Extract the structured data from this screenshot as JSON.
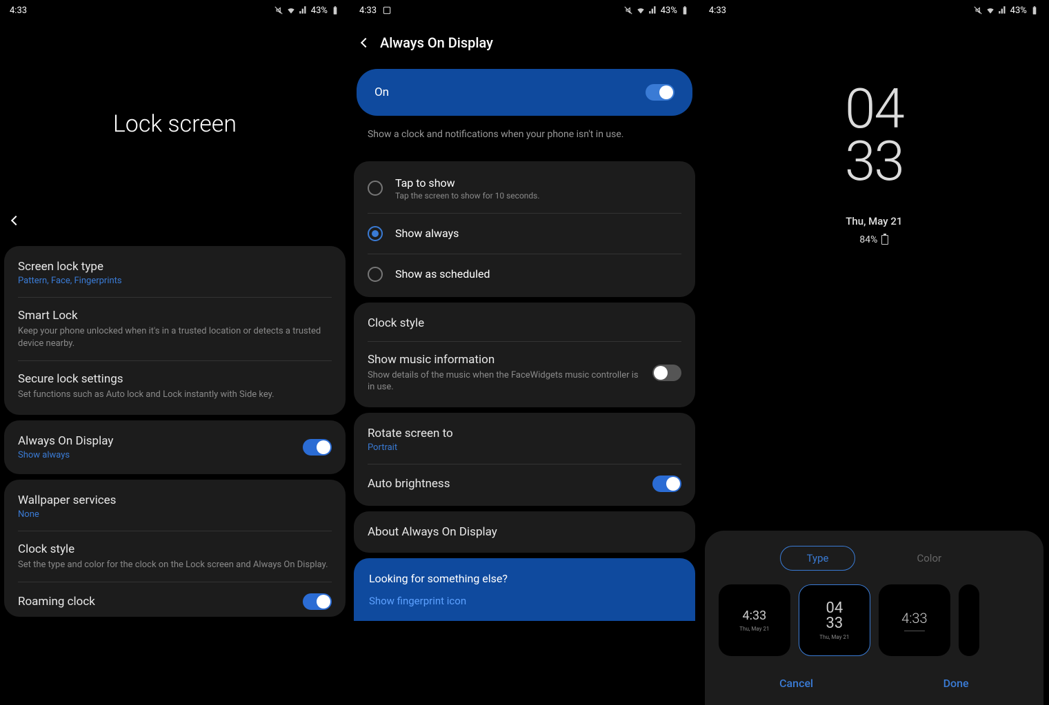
{
  "status": {
    "time": "4:33",
    "battery": "43%"
  },
  "screen1": {
    "title": "Lock screen",
    "group1": {
      "lock_type": {
        "title": "Screen lock type",
        "sub": "Pattern, Face, Fingerprints"
      },
      "smart_lock": {
        "title": "Smart Lock",
        "sub": "Keep your phone unlocked when it's in a trusted location or detects a trusted device nearby."
      },
      "secure": {
        "title": "Secure lock settings",
        "sub": "Set functions such as Auto lock and Lock instantly with Side key."
      }
    },
    "aod": {
      "title": "Always On Display",
      "sub": "Show always"
    },
    "group3": {
      "wallpaper": {
        "title": "Wallpaper services",
        "sub": "None"
      },
      "clock_style": {
        "title": "Clock style",
        "sub": "Set the type and color for the clock on the Lock screen and Always On Display."
      },
      "roaming": {
        "title": "Roaming clock"
      }
    }
  },
  "screen2": {
    "header": "Always On Display",
    "on_label": "On",
    "desc": "Show a clock and notifications when your phone isn't in use.",
    "radios": {
      "tap": {
        "title": "Tap to show",
        "sub": "Tap the screen to show for 10 seconds."
      },
      "always": {
        "title": "Show always"
      },
      "scheduled": {
        "title": "Show as scheduled"
      }
    },
    "group2": {
      "clock_style": "Clock style",
      "music": {
        "title": "Show music information",
        "sub": "Show details of the music when the FaceWidgets music controller is in use."
      }
    },
    "group3": {
      "rotate": {
        "title": "Rotate screen to",
        "sub": "Portrait"
      },
      "autobright": "Auto brightness"
    },
    "about": "About Always On Display",
    "suggest": {
      "title": "Looking for something else?",
      "link": "Show fingerprint icon"
    }
  },
  "screen3": {
    "clock_h": "04",
    "clock_m": "33",
    "date": "Thu, May 21",
    "battery": "84%",
    "tabs": {
      "type": "Type",
      "color": "Color"
    },
    "tiles": {
      "t1_time": "4:33",
      "t1_sub": "Thu, May 21",
      "t2_h": "04",
      "t2_m": "33",
      "t2_sub": "Thu, May 21",
      "t3_time": "4:33"
    },
    "cancel": "Cancel",
    "done": "Done"
  }
}
